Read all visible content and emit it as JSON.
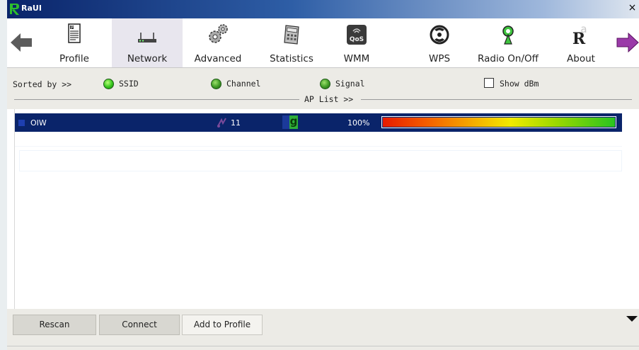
{
  "window": {
    "title": "RaUI",
    "close_glyph": "×"
  },
  "toolbar": {
    "buttons": [
      {
        "label": "Profile",
        "icon": "profile-icon"
      },
      {
        "label": "Network",
        "icon": "router-icon"
      },
      {
        "label": "Advanced",
        "icon": "gears-icon"
      },
      {
        "label": "Statistics",
        "icon": "calculator-icon"
      },
      {
        "label": "WMM",
        "icon": "qos-icon",
        "icon_text": "QoS"
      },
      {
        "label": "WPS",
        "icon": "wps-icon"
      },
      {
        "label": "Radio On/Off",
        "icon": "radio-icon"
      },
      {
        "label": "About",
        "icon": "about-icon",
        "icon_text": "R"
      }
    ],
    "selected": "Network"
  },
  "sort": {
    "label": "Sorted by >>",
    "options": [
      "SSID",
      "Channel",
      "Signal"
    ],
    "show_dbm_label": "Show dBm",
    "show_dbm_checked": false,
    "ap_list_label": "AP List >>"
  },
  "ap_list": [
    {
      "ssid": "OIW",
      "channel": "11",
      "mode_icon": "g",
      "signal": "100%",
      "signal_fraction": 1.0
    }
  ],
  "buttons": {
    "rescan": "Rescan",
    "connect": "Connect",
    "add_to_profile": "Add to Profile"
  },
  "colors": {
    "selection": "#0a246a",
    "title_gradient_start": "#0a246a",
    "signal_start": "#e61a00",
    "signal_end": "#29c41f"
  }
}
